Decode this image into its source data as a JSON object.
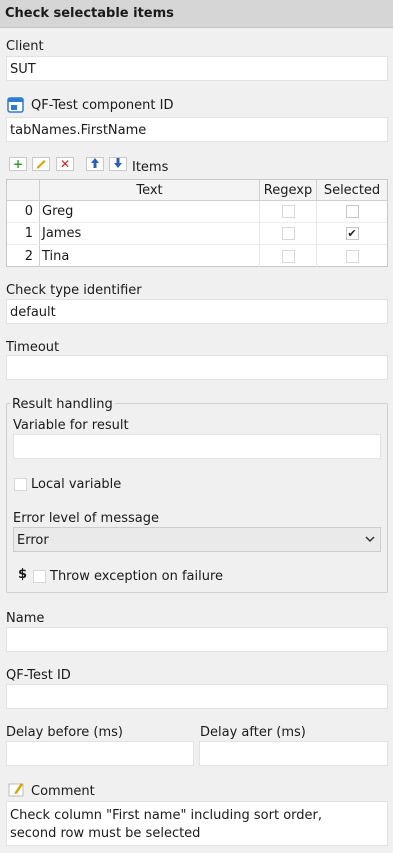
{
  "header": {
    "title": "Check selectable items"
  },
  "client": {
    "label": "Client",
    "value": "SUT"
  },
  "component": {
    "label": "QF-Test component ID",
    "value": "tabNames.FirstName"
  },
  "items": {
    "toolbar_label": "Items",
    "columns": [
      "Text",
      "Regexp",
      "Selected"
    ],
    "rows": [
      {
        "index": "0",
        "text": "Greg",
        "regexp": false,
        "selected": false
      },
      {
        "index": "1",
        "text": "James",
        "regexp": false,
        "selected": true
      },
      {
        "index": "2",
        "text": "Tina",
        "regexp": false,
        "selected": false
      }
    ]
  },
  "check_type": {
    "label": "Check type identifier",
    "value": "default"
  },
  "timeout": {
    "label": "Timeout",
    "value": ""
  },
  "result_handling": {
    "legend": "Result handling",
    "variable_label": "Variable for result",
    "variable_value": "",
    "local_variable_label": "Local variable",
    "error_level_label": "Error level of message",
    "error_level_value": "Error",
    "dollar": "$",
    "throw_label": "Throw exception on failure"
  },
  "name": {
    "label": "Name",
    "value": ""
  },
  "qftest_id": {
    "label": "QF-Test ID",
    "value": ""
  },
  "delay_before": {
    "label": "Delay before (ms)",
    "value": ""
  },
  "delay_after": {
    "label": "Delay after (ms)",
    "value": ""
  },
  "comment": {
    "label": "Comment",
    "line1": "Check column \"First name\" including sort order,",
    "line2": "second row must be selected"
  },
  "colors": {
    "add": "#2a9d2a",
    "delete": "#d02020",
    "arrow": "#2d5fb3",
    "edit": "#d9a400",
    "icon_blue": "#2f7bd0"
  }
}
